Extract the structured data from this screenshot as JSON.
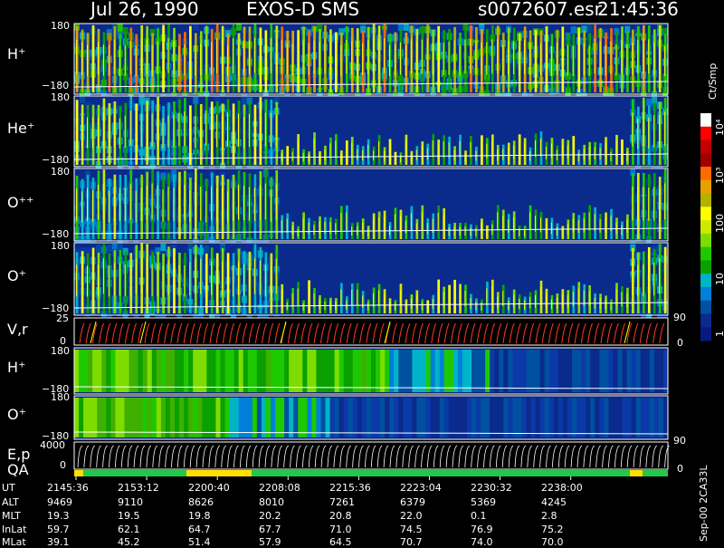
{
  "header": {
    "date": "Jul 26, 1990",
    "instrument": "EXOS-D SMS",
    "file": "s0072607.esr",
    "time": "21:45:36"
  },
  "colorbar": {
    "title": "Ct/Smp",
    "labels": [
      "10⁴",
      "10³",
      "100",
      "10",
      "1"
    ],
    "colors": [
      "#ffffff",
      "#ff0000",
      "#c00000",
      "#a00000",
      "#ff6a00",
      "#e8a000",
      "#b3b000",
      "#ffff00",
      "#cfe800",
      "#7fdc00",
      "#1ec800",
      "#0aa000",
      "#00b4c8",
      "#0080d8",
      "#0050a0",
      "#0a2a90",
      "#081a80"
    ]
  },
  "right_scale": {
    "vr_top": "90",
    "vr_bottom": "0",
    "ep_top": "90",
    "ep_bottom": "0"
  },
  "side_note": "Sep-00 2CA33L",
  "footer": {
    "row_labels": [
      "UT",
      "ALT",
      "MLT",
      "InLat",
      "MLat"
    ],
    "rows": [
      [
        "2145:36",
        "2153:12",
        "2200:40",
        "2208:08",
        "2215:36",
        "2223:04",
        "2230:32",
        "2238:00"
      ],
      [
        "9469",
        "9110",
        "8626",
        "8010",
        "7261",
        "6379",
        "5369",
        "4245"
      ],
      [
        "19.3",
        "19.5",
        "19.8",
        "20.2",
        "20.8",
        "22.0",
        "0.1",
        "2.8"
      ],
      [
        "59.7",
        "62.1",
        "64.7",
        "67.7",
        "71.0",
        "74.5",
        "76.9",
        "75.2"
      ],
      [
        "39.1",
        "45.2",
        "51.4",
        "57.9",
        "64.5",
        "70.7",
        "74.0",
        "70.0"
      ]
    ]
  },
  "chart_data": {
    "type": "heatmap",
    "x_label": "UT",
    "x_ticks": [
      "2145:36",
      "2153:12",
      "2200:40",
      "2208:08",
      "2215:36",
      "2223:04",
      "2230:32",
      "2238:00"
    ],
    "panels": [
      {
        "label": "H⁺",
        "y_top": "180",
        "y_bottom": "−180"
      },
      {
        "label": "He⁺",
        "y_top": "180",
        "y_bottom": "−180"
      },
      {
        "label": "O⁺⁺",
        "y_top": "180",
        "y_bottom": "−180"
      },
      {
        "label": "O⁺",
        "y_top": "180",
        "y_bottom": "−180"
      },
      {
        "label": "V,r",
        "y_top": "25",
        "y_bottom": "0"
      },
      {
        "label": "H⁺",
        "y_top": "180",
        "y_bottom": "−180"
      },
      {
        "label": "O⁺",
        "y_top": "180",
        "y_bottom": "−180"
      },
      {
        "label": "E,p",
        "y_top": "4000",
        "y_bottom": "0"
      },
      {
        "label": "QA",
        "y_top": "",
        "y_bottom": ""
      }
    ],
    "color_scale": {
      "unit": "Ct/Smp",
      "min": 1,
      "max": 10000,
      "log": true
    }
  }
}
